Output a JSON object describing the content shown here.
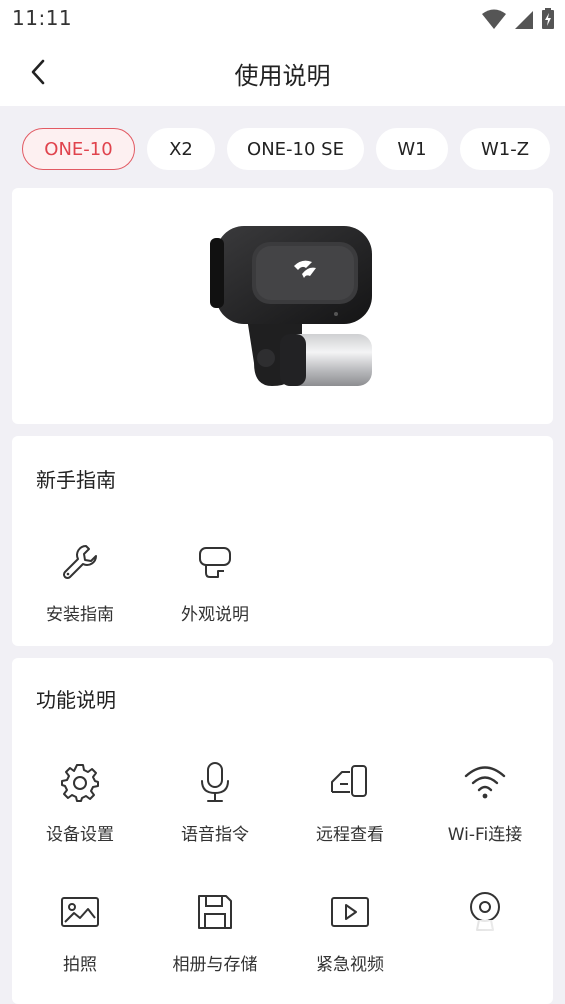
{
  "status_bar": {
    "time": "11:11"
  },
  "header": {
    "title": "使用说明"
  },
  "tabs": [
    {
      "label": "ONE-10",
      "active": true
    },
    {
      "label": "X2"
    },
    {
      "label": "ONE-10 SE"
    },
    {
      "label": "W1"
    },
    {
      "label": "W1-Z"
    }
  ],
  "guide": {
    "title": "新手指南",
    "items": [
      {
        "label": "安装指南",
        "icon": "wrench-icon"
      },
      {
        "label": "外观说明",
        "icon": "device-outline-icon"
      }
    ]
  },
  "features": {
    "title": "功能说明",
    "items": [
      {
        "label": "设备设置",
        "icon": "gear-icon"
      },
      {
        "label": "语音指令",
        "icon": "microphone-icon"
      },
      {
        "label": "远程查看",
        "icon": "remote-view-icon"
      },
      {
        "label": "Wi-Fi连接",
        "icon": "wifi-icon"
      },
      {
        "label": "拍照",
        "icon": "photo-icon"
      },
      {
        "label": "相册与存储",
        "icon": "storage-icon"
      },
      {
        "label": "紧急视频",
        "icon": "video-play-icon"
      },
      {
        "label": "",
        "icon": "webcam-icon"
      }
    ]
  },
  "colors": {
    "accent": "#e0434d",
    "background": "#f1f0f5"
  }
}
